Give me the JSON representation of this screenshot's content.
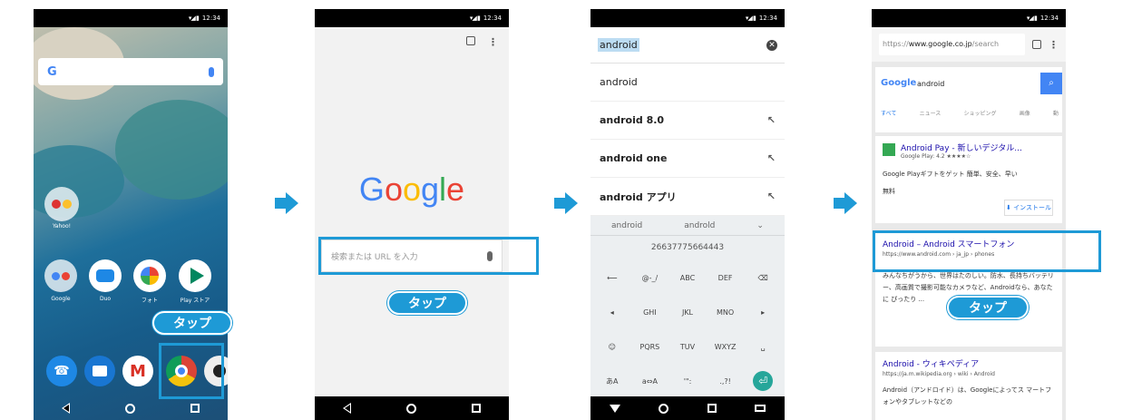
{
  "common": {
    "status_time": "12:34",
    "status_icons": "▾◢ ▮",
    "tap_label": "タップ"
  },
  "phone1": {
    "search_logo": "G",
    "apps": [
      {
        "label": "Yahoo!"
      },
      {
        "label": "Google"
      },
      {
        "label": "Duo"
      },
      {
        "label": "フォト"
      },
      {
        "label": "Play ストア"
      }
    ]
  },
  "phone2": {
    "google_logo": [
      "G",
      "o",
      "o",
      "g",
      "l",
      "e"
    ],
    "search_placeholder": "検索または URL を入力"
  },
  "phone3": {
    "typed_query": "android",
    "suggestions": [
      {
        "text": "android"
      },
      {
        "text": "android 8.0"
      },
      {
        "text": "android one"
      },
      {
        "text": "android アプリ"
      }
    ],
    "kb_candidates": [
      "android",
      "androld"
    ],
    "kb_number": "26637775664443",
    "keys": [
      "⟵",
      "@-_/",
      "ABC",
      "DEF",
      "⌫",
      "◂",
      "GHI",
      "JKL",
      "MNO",
      "▸",
      "☺",
      "PQRS",
      "TUV",
      "WXYZ",
      "␣",
      "あA",
      "a⇔A",
      "'\":",
      ".,?!",
      "⏎"
    ]
  },
  "phone4": {
    "url_prefix": "https://",
    "url_main": "www.google.co.jp",
    "url_suffix": "/search",
    "logo": "Google",
    "query": "android",
    "tabs": [
      "すべて",
      "ニュース",
      "ショッピング",
      "画像",
      "動"
    ],
    "ad_title": "Android Pay - 新しいデジタル...",
    "ad_sub": "Google Play: 4.2 ★★★★☆",
    "ad_text": "Google Playギフトをゲット 簡単、安全、早い",
    "ad_price": "無料",
    "ad_install": "インストール",
    "result1_title": "Android – Android スマートフォン",
    "result1_url": "https://www.android.com › ja_jp › phones",
    "result1_text": "みんなちがうから、世界はたのしい。防水、長持ちバッテリー、高画質で撮影可能なカメラなど、Androidなら、あなたに ぴったり ...",
    "result2_title": "Android - ウィキペディア",
    "result2_url": "https://ja.m.wikipedia.org › wiki › Android",
    "result2_text": "Android（アンドロイド）は、Googleによってス マートフォンやタブレットなどの"
  }
}
